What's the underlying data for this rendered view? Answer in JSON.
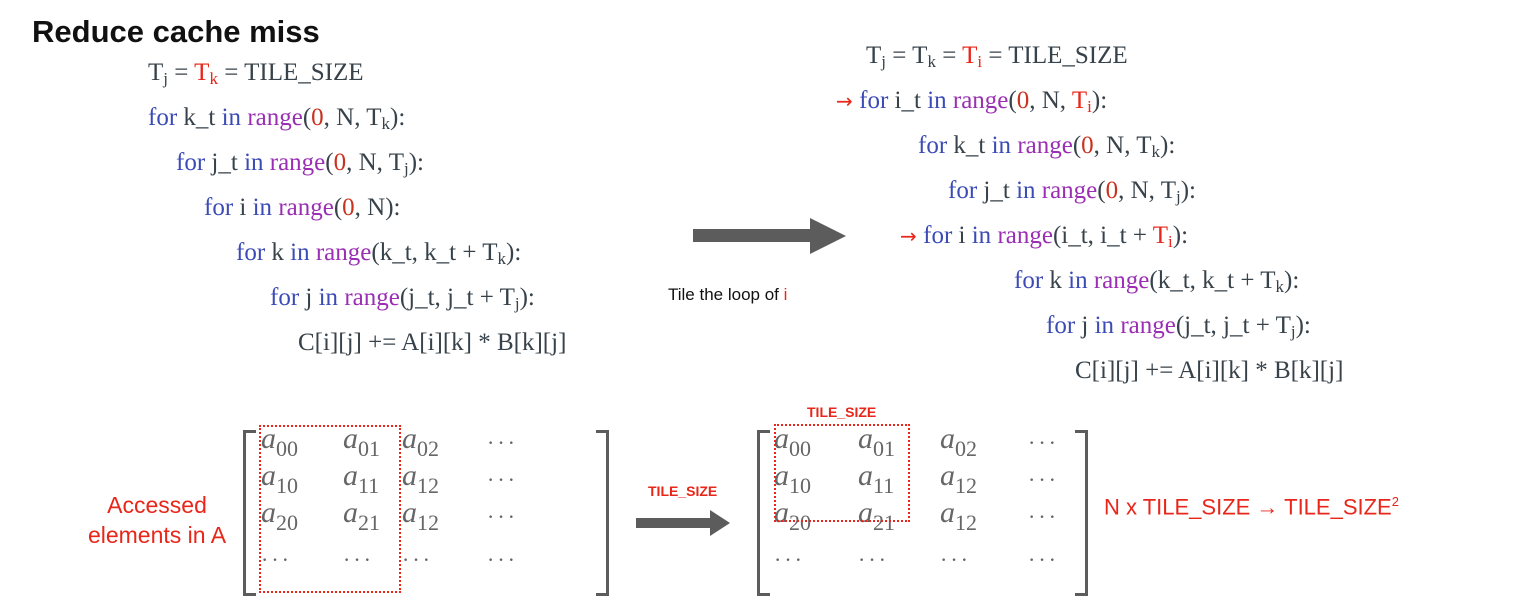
{
  "title": "Reduce cache miss",
  "left_code": {
    "line0": {
      "t_j": "T",
      "j": "j",
      "eq1": " = ",
      "t_k": "T",
      "k": "k",
      "rest": " = TILE_SIZE"
    },
    "line1": {
      "for": "for ",
      "var": "k_t ",
      "in": "in ",
      "range": "range",
      "open": "(",
      "zero": "0",
      "mid": ", N, T",
      "sub": "k",
      "close": "):"
    },
    "line2": {
      "for": "for ",
      "var": "j_t ",
      "in": "in ",
      "range": "range",
      "open": "(",
      "zero": "0",
      "mid": ", N, T",
      "sub": "j",
      "close": "):"
    },
    "line3": {
      "for": "for ",
      "var": "i ",
      "in": "in ",
      "range": "range",
      "open": "(",
      "zero": "0",
      "close": ", N):"
    },
    "line4": {
      "for": "for ",
      "var": "k ",
      "in": "in ",
      "range": "range",
      "args": "(k_t, k_t + T",
      "sub": "k",
      "close": "):"
    },
    "line5": {
      "for": "for ",
      "var": "j ",
      "in": "in ",
      "range": "range",
      "args": "(j_t, j_t + T",
      "sub": "j",
      "close": "):"
    },
    "line6": {
      "text": "C[i][j] += A[i][k] * B[k][j]"
    }
  },
  "right_code": {
    "line0": {
      "a": "T",
      "a_sub": "j",
      "b": " = T",
      "b_sub": "k",
      "eq": " = ",
      "c": "T",
      "c_sub": "i",
      "rest": " = TILE_SIZE"
    },
    "line1": {
      "marker": "→ ",
      "for": "for ",
      "var": "i_t ",
      "in": "in ",
      "range": "range",
      "open": "(",
      "zero": "0",
      "mid": ", N, ",
      "t": "T",
      "sub": "i",
      "close": "):"
    },
    "line2": {
      "for": "for ",
      "var": "k_t ",
      "in": "in ",
      "range": "range",
      "open": "(",
      "zero": "0",
      "mid": ", N, T",
      "sub": "k",
      "close": "):"
    },
    "line3": {
      "for": "for ",
      "var": "j_t ",
      "in": "in ",
      "range": "range",
      "open": "(",
      "zero": "0",
      "mid": ", N, T",
      "sub": "j",
      "close": "):"
    },
    "line4": {
      "marker": "→ ",
      "for": "for ",
      "var": "i ",
      "in": "in ",
      "range": "range",
      "args": "(i_t, i_t + ",
      "t": "T",
      "sub": "i",
      "close": "):"
    },
    "line5": {
      "for": "for ",
      "var": "k ",
      "in": "in ",
      "range": "range",
      "args": "(k_t, k_t + T",
      "sub": "k",
      "close": "):"
    },
    "line6": {
      "for": "for ",
      "var": "j ",
      "in": "in ",
      "range": "range",
      "args": "(j_t, j_t + T",
      "sub": "j",
      "close": "):"
    },
    "line7": {
      "text": "C[i][j] += A[i][k] * B[k][j]"
    }
  },
  "transform_caption": {
    "prefix": "Tile the loop of ",
    "highlight": "i"
  },
  "accessed_label": {
    "line1": "Accessed",
    "line2": "elements in A"
  },
  "tile_size_label": "TILE_SIZE",
  "complexity": {
    "text": "N x TILE_SIZE → TILE_SIZE",
    "sup": "2"
  },
  "matrix_left": {
    "rows": [
      [
        {
          "b": "a",
          "s": "00"
        },
        {
          "b": "a",
          "s": "01"
        },
        {
          "b": "a",
          "s": "02"
        },
        {
          "dots": "···"
        }
      ],
      [
        {
          "b": "a",
          "s": "10"
        },
        {
          "b": "a",
          "s": "11"
        },
        {
          "b": "a",
          "s": "12"
        },
        {
          "dots": "···"
        }
      ],
      [
        {
          "b": "a",
          "s": "20"
        },
        {
          "b": "a",
          "s": "21"
        },
        {
          "b": "a",
          "s": "12"
        },
        {
          "dots": "···"
        }
      ],
      [
        {
          "dots": "···"
        },
        {
          "dots": "···"
        },
        {
          "dots": "···"
        },
        {
          "dots": "···"
        }
      ]
    ]
  },
  "matrix_right": {
    "rows": [
      [
        {
          "b": "a",
          "s": "00"
        },
        {
          "b": "a",
          "s": "01"
        },
        {
          "b": "a",
          "s": "02"
        },
        {
          "dots": "···"
        }
      ],
      [
        {
          "b": "a",
          "s": "10"
        },
        {
          "b": "a",
          "s": "11"
        },
        {
          "b": "a",
          "s": "12"
        },
        {
          "dots": "···"
        }
      ],
      [
        {
          "b": "a",
          "s": "20"
        },
        {
          "b": "a",
          "s": "21"
        },
        {
          "b": "a",
          "s": "12"
        },
        {
          "dots": "···"
        }
      ],
      [
        {
          "dots": "···"
        },
        {
          "dots": "···"
        },
        {
          "dots": "···"
        },
        {
          "dots": "···"
        }
      ]
    ]
  },
  "colors": {
    "keyword": "#3b4bb5",
    "function": "#9a2fb3",
    "number": "#c8321e",
    "highlight": "#e8261a",
    "text": "#37424a",
    "arrow": "#5c5c5c"
  }
}
